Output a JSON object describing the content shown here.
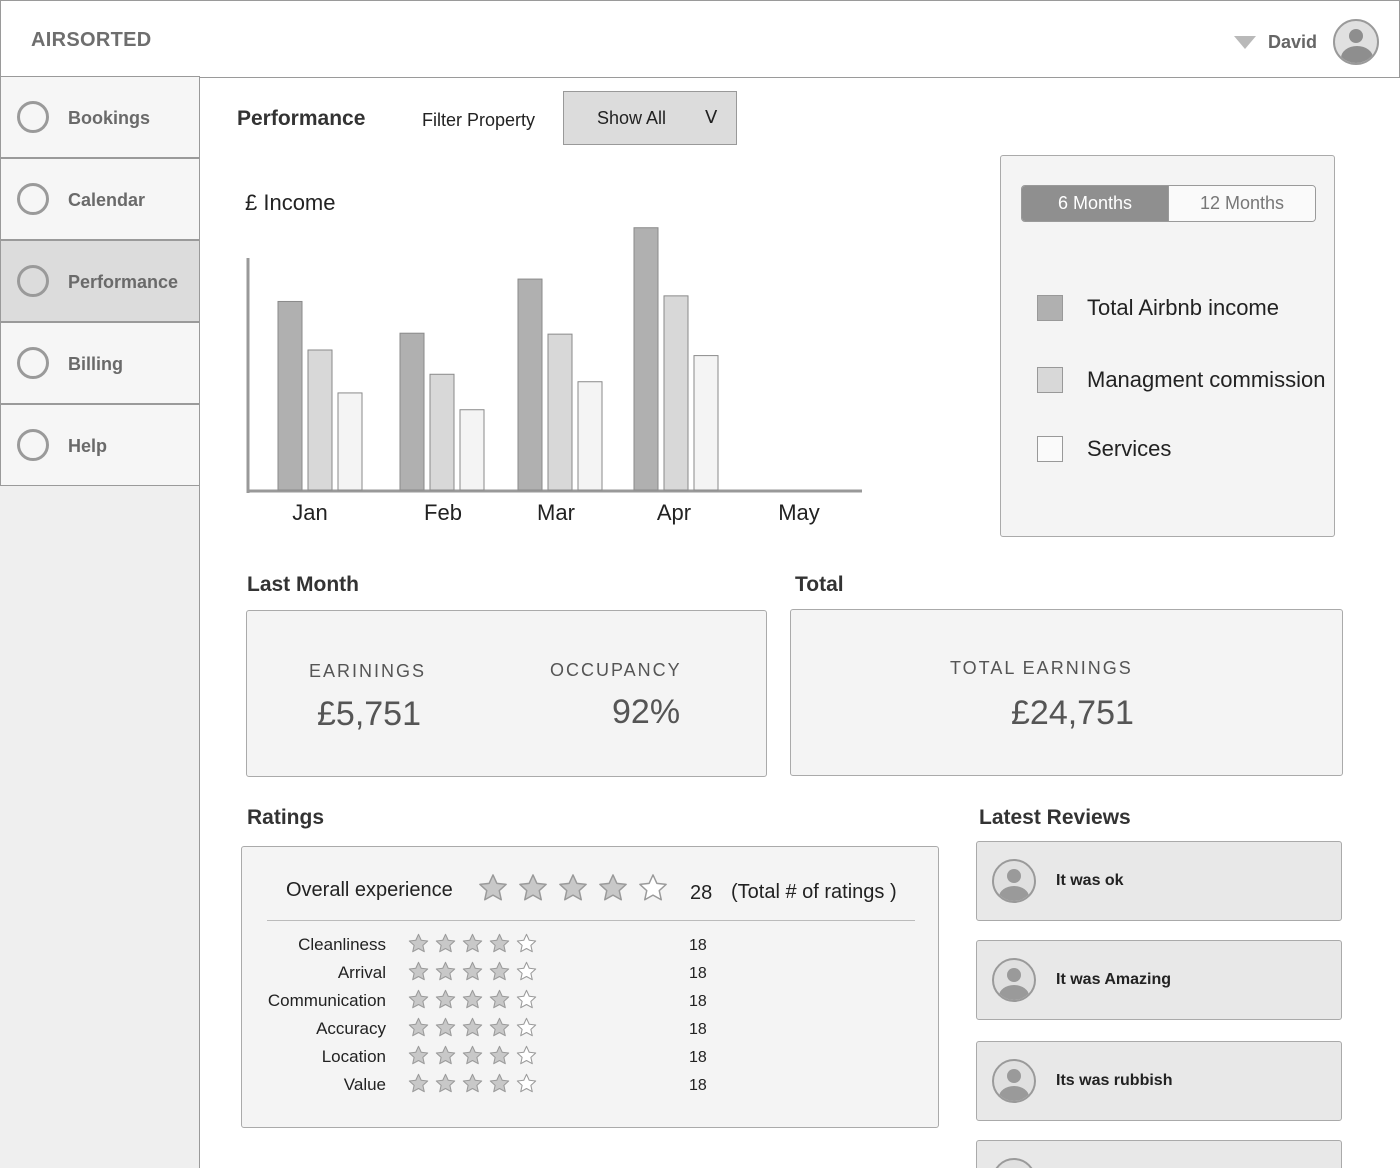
{
  "app": {
    "logo": "AIRSORTED"
  },
  "user": {
    "name": "David"
  },
  "sidebar": {
    "items": [
      {
        "label": "Bookings",
        "active": false
      },
      {
        "label": "Calendar",
        "active": false
      },
      {
        "label": "Performance",
        "active": true
      },
      {
        "label": "Billing",
        "active": false
      },
      {
        "label": "Help",
        "active": false
      }
    ]
  },
  "toolbar": {
    "title": "Performance",
    "filter_label": "Filter Property",
    "filter_value": "Show All",
    "filter_chevron": "V"
  },
  "chart_data": {
    "type": "bar",
    "title": "",
    "ylabel": "£ Income",
    "xlabel": "",
    "categories": [
      "Jan",
      "Feb",
      "Mar",
      "Apr",
      "May"
    ],
    "series": [
      {
        "name": "Total Airbnb income",
        "color": "#b0b0b0",
        "values": [
          202,
          168,
          226,
          281,
          null
        ]
      },
      {
        "name": "Managment commission",
        "color": "#d8d8d8",
        "values": [
          150,
          124,
          167,
          208,
          null
        ]
      },
      {
        "name": "Services",
        "color": "#f4f4f4",
        "values": [
          104,
          86,
          116,
          144,
          null
        ]
      }
    ],
    "ylim": [
      0,
      300
    ],
    "grid": false,
    "legend": "right"
  },
  "period_toggle": {
    "options": [
      "6 Months",
      "12 Months"
    ],
    "selected": "6 Months"
  },
  "legend": {
    "items": [
      {
        "label": "Total Airbnb income",
        "color": "#b0b0b0"
      },
      {
        "label": "Managment commission",
        "color": "#d8d8d8"
      },
      {
        "label": "Services",
        "color": "#fafafa"
      }
    ]
  },
  "last_month": {
    "title": "Last Month",
    "earnings_label": "EARININGS",
    "earnings_value": "£5,751",
    "occupancy_label": "OCCUPANCY",
    "occupancy_value": "92%"
  },
  "total": {
    "title": "Total",
    "earnings_label": "TOTAL EARNINGS",
    "earnings_value": "£24,751"
  },
  "ratings": {
    "title": "Ratings",
    "overall": {
      "label": "Overall experience",
      "stars": 4,
      "count": "28",
      "note": "(Total # of ratings )"
    },
    "rows": [
      {
        "label": "Cleanliness",
        "stars": 4,
        "count": "18"
      },
      {
        "label": "Arrival",
        "stars": 4,
        "count": "18"
      },
      {
        "label": "Communication",
        "stars": 4,
        "count": "18"
      },
      {
        "label": "Accuracy",
        "stars": 4,
        "count": "18"
      },
      {
        "label": "Location",
        "stars": 4,
        "count": "18"
      },
      {
        "label": "Value",
        "stars": 4,
        "count": "18"
      }
    ]
  },
  "reviews": {
    "title": "Latest Reviews",
    "items": [
      {
        "text": "It was ok"
      },
      {
        "text": "It was Amazing"
      },
      {
        "text": "Its was rubbish"
      },
      {
        "text": ""
      }
    ]
  }
}
